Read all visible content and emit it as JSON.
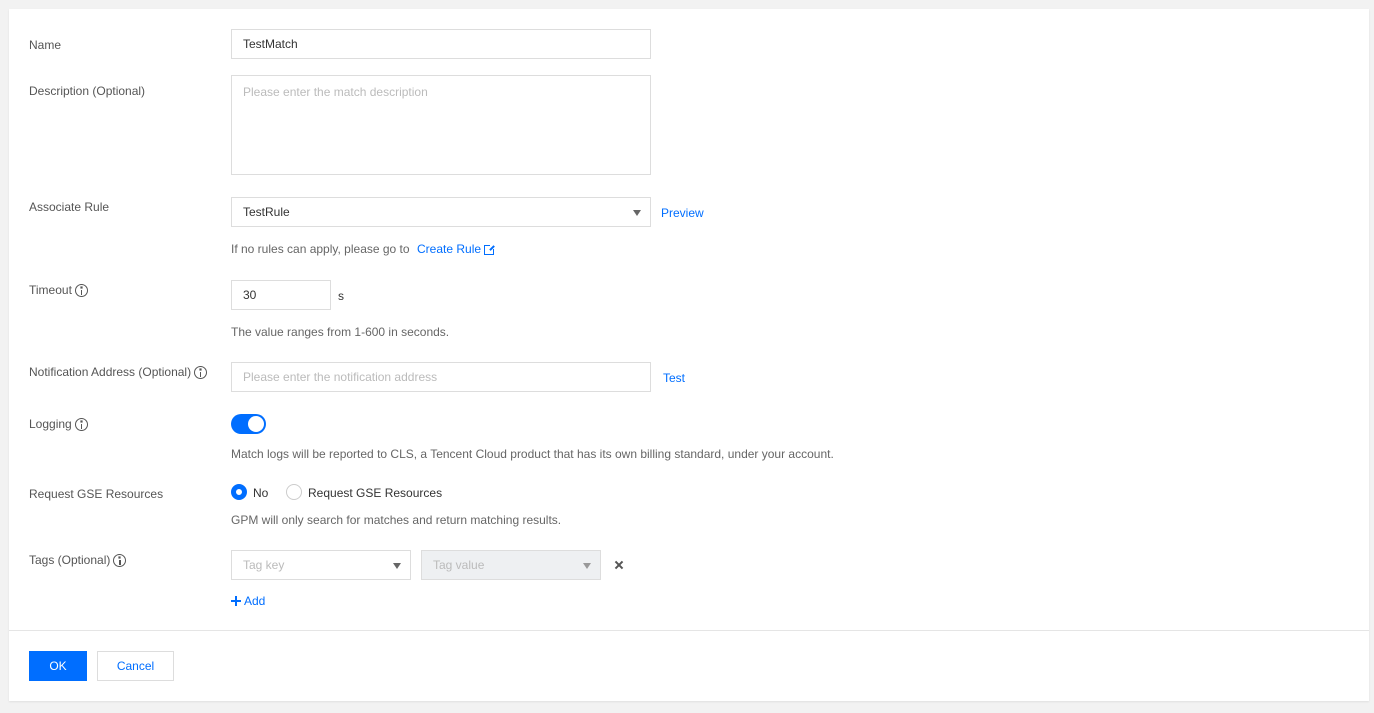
{
  "form": {
    "name": {
      "label": "Name",
      "value": "TestMatch"
    },
    "description": {
      "label": "Description (Optional)",
      "placeholder": "Please enter the match description"
    },
    "associate_rule": {
      "label": "Associate Rule",
      "selected": "TestRule",
      "preview_link": "Preview",
      "hint_prefix": "If no rules can apply, please go to",
      "create_rule_link": "Create Rule"
    },
    "timeout": {
      "label": "Timeout",
      "value": "30",
      "unit": "s",
      "hint": "The value ranges from 1-600 in seconds."
    },
    "notification": {
      "label": "Notification Address (Optional)",
      "placeholder": "Please enter the notification address",
      "test_link": "Test"
    },
    "logging": {
      "label": "Logging",
      "enabled": true,
      "hint": "Match logs will be reported to CLS, a Tencent Cloud product that has its own billing standard, under your account."
    },
    "gse": {
      "label": "Request GSE Resources",
      "options": [
        {
          "label": "No",
          "checked": true
        },
        {
          "label": "Request GSE Resources",
          "checked": false
        }
      ],
      "hint": "GPM will only search for matches and return matching results."
    },
    "tags": {
      "label": "Tags (Optional)",
      "key_placeholder": "Tag key",
      "value_placeholder": "Tag value",
      "add_label": "Add"
    }
  },
  "footer": {
    "ok_label": "OK",
    "cancel_label": "Cancel"
  },
  "colors": {
    "accent": "#006eff",
    "background": "#f2f2f2",
    "card": "#ffffff"
  }
}
